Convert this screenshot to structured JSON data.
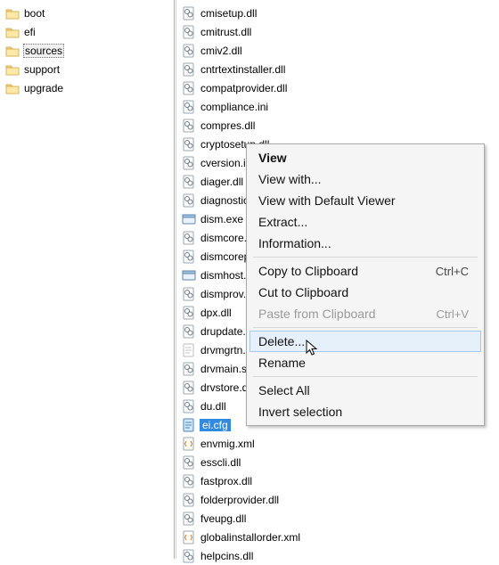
{
  "tree": {
    "items": [
      {
        "label": "boot",
        "selected": false
      },
      {
        "label": "efi",
        "selected": false
      },
      {
        "label": "sources",
        "selected": true
      },
      {
        "label": "support",
        "selected": false
      },
      {
        "label": "upgrade",
        "selected": false
      }
    ]
  },
  "files": {
    "items": [
      {
        "label": "cmisetup.dll",
        "kind": "dll",
        "selected": false
      },
      {
        "label": "cmitrust.dll",
        "kind": "dll",
        "selected": false
      },
      {
        "label": "cmiv2.dll",
        "kind": "dll",
        "selected": false
      },
      {
        "label": "cntrtextinstaller.dll",
        "kind": "dll",
        "selected": false
      },
      {
        "label": "compatprovider.dll",
        "kind": "dll",
        "selected": false
      },
      {
        "label": "compliance.ini",
        "kind": "ini",
        "selected": false
      },
      {
        "label": "compres.dll",
        "kind": "dll",
        "selected": false
      },
      {
        "label": "cryptosetup.dll",
        "kind": "dll",
        "selected": false
      },
      {
        "label": "cversion.ini",
        "kind": "ini",
        "selected": false
      },
      {
        "label": "diager.dll",
        "kind": "dll",
        "selected": false
      },
      {
        "label": "diagnostic.dll",
        "kind": "dll",
        "selected": false
      },
      {
        "label": "dism.exe",
        "kind": "exe",
        "selected": false
      },
      {
        "label": "dismcore.dll",
        "kind": "dll",
        "selected": false
      },
      {
        "label": "dismcoreps.dll",
        "kind": "dll",
        "selected": false
      },
      {
        "label": "dismhost.exe",
        "kind": "exe",
        "selected": false
      },
      {
        "label": "dismprov.dll",
        "kind": "dll",
        "selected": false
      },
      {
        "label": "dpx.dll",
        "kind": "dll",
        "selected": false
      },
      {
        "label": "drupdate.dll",
        "kind": "dll",
        "selected": false
      },
      {
        "label": "drvmgrtn.dll",
        "kind": "txt",
        "selected": false
      },
      {
        "label": "drvmain.sdb",
        "kind": "dll",
        "selected": false
      },
      {
        "label": "drvstore.dll",
        "kind": "dll",
        "selected": false
      },
      {
        "label": "du.dll",
        "kind": "dll",
        "selected": false
      },
      {
        "label": "ei.cfg",
        "kind": "cfg",
        "selected": true
      },
      {
        "label": "envmig.xml",
        "kind": "xml",
        "selected": false
      },
      {
        "label": "esscli.dll",
        "kind": "dll",
        "selected": false
      },
      {
        "label": "fastprox.dll",
        "kind": "dll",
        "selected": false
      },
      {
        "label": "folderprovider.dll",
        "kind": "dll",
        "selected": false
      },
      {
        "label": "fveupg.dll",
        "kind": "dll",
        "selected": false
      },
      {
        "label": "globalinstallorder.xml",
        "kind": "xml",
        "selected": false
      },
      {
        "label": "helpcins.dll",
        "kind": "dll",
        "selected": false
      }
    ]
  },
  "menu": {
    "items": [
      {
        "label": "View",
        "bold": true
      },
      {
        "label": "View with..."
      },
      {
        "label": "View with Default Viewer"
      },
      {
        "label": "Extract..."
      },
      {
        "label": "Information..."
      },
      {
        "sep": true
      },
      {
        "label": "Copy to Clipboard",
        "shortcut": "Ctrl+C"
      },
      {
        "label": "Cut to Clipboard"
      },
      {
        "label": "Paste from Clipboard",
        "shortcut": "Ctrl+V",
        "disabled": true
      },
      {
        "sep": true
      },
      {
        "label": "Delete...",
        "hover": true
      },
      {
        "label": "Rename"
      },
      {
        "sep": true
      },
      {
        "label": "Select All"
      },
      {
        "label": "Invert selection"
      }
    ]
  }
}
